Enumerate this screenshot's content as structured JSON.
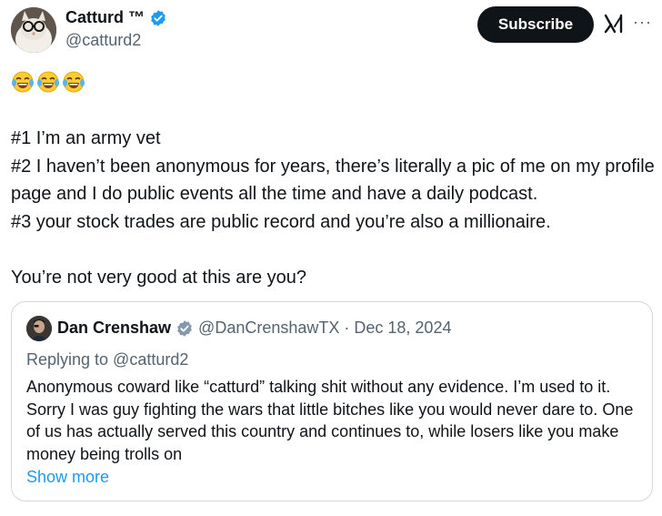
{
  "author": {
    "name": "Catturd ™",
    "handle": "@catturd2",
    "verified_color": "#1d9bf0"
  },
  "actions": {
    "subscribe_label": "Subscribe",
    "grok_icon": "grok-icon",
    "more_icon": "more-icon"
  },
  "tweet": {
    "emojis": [
      "face-with-tears-of-joy",
      "face-with-tears-of-joy",
      "face-with-tears-of-joy"
    ],
    "text": "#1 I’m an army vet\n#2 I haven’t been anonymous for years, there’s literally a pic of me on my profile page and I do public events all the time and have a daily podcast.\n#3 your stock trades are public record and you’re also a millionaire.\n\nYou’re not very good at this are you?"
  },
  "quote": {
    "name": "Dan Crenshaw",
    "handle": "@DanCrenshawTX",
    "separator": "·",
    "date": "Dec 18, 2024",
    "verified_color": "#829aab",
    "replying_to": "Replying to @catturd2",
    "text": "Anonymous coward like “catturd” talking shit without any evidence. I’m used to it. Sorry I was guy fighting the wars that little bitches like you would never dare to. One of us has actually served this country and continues to, while losers like you make money being trolls on",
    "show_more": "Show more"
  }
}
